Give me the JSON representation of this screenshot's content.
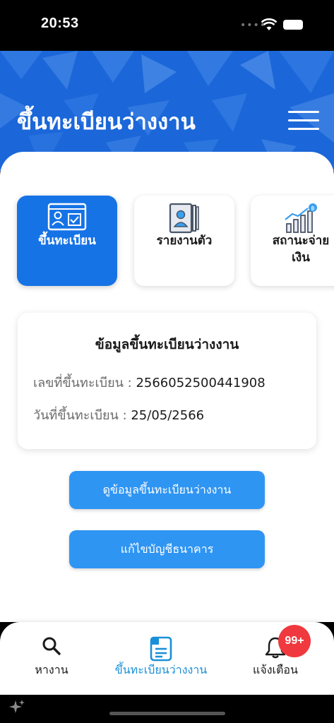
{
  "status_bar": {
    "time": "20:53"
  },
  "header": {
    "title": "ขึ้นทะเบียนว่างงาน"
  },
  "quick_menu": [
    {
      "label": "ขึ้นทะเบียน",
      "icon": "id-card-check-icon",
      "active": true
    },
    {
      "label": "รายงานตัว",
      "icon": "person-book-icon",
      "active": false
    },
    {
      "label": "สถานะจ่าย\nเงิน",
      "icon": "growth-chart-baht-icon",
      "active": false
    }
  ],
  "info_card": {
    "title": "ข้อมูลขึ้นทะเบียนว่างงาน",
    "reg_no_label": "เลขที่ขึ้นทะเบียน : ",
    "reg_no_value": "2566052500441908",
    "reg_date_label": "วันที่ขึ้นทะเบียน : ",
    "reg_date_value": "25/05/2566"
  },
  "buttons": {
    "view_info": "ดูข้อมูลขึ้นทะเบียนว่างงาน",
    "edit_bank": "แก้ไขบัญชีธนาคาร"
  },
  "bottom_nav": {
    "items": [
      {
        "label": "หางาน",
        "icon": "search-icon"
      },
      {
        "label": "ขึ้นทะเบียนว่างงาน",
        "icon": "document-icon"
      },
      {
        "label": "แจ้งเตือน",
        "icon": "bell-icon"
      }
    ],
    "badge": "99+"
  },
  "colors": {
    "header_blue": "#1b67d9",
    "active_card": "#1673e6",
    "button_blue": "#2f95f3",
    "active_nav": "#1a8fd8",
    "badge_red": "#f0393e"
  }
}
